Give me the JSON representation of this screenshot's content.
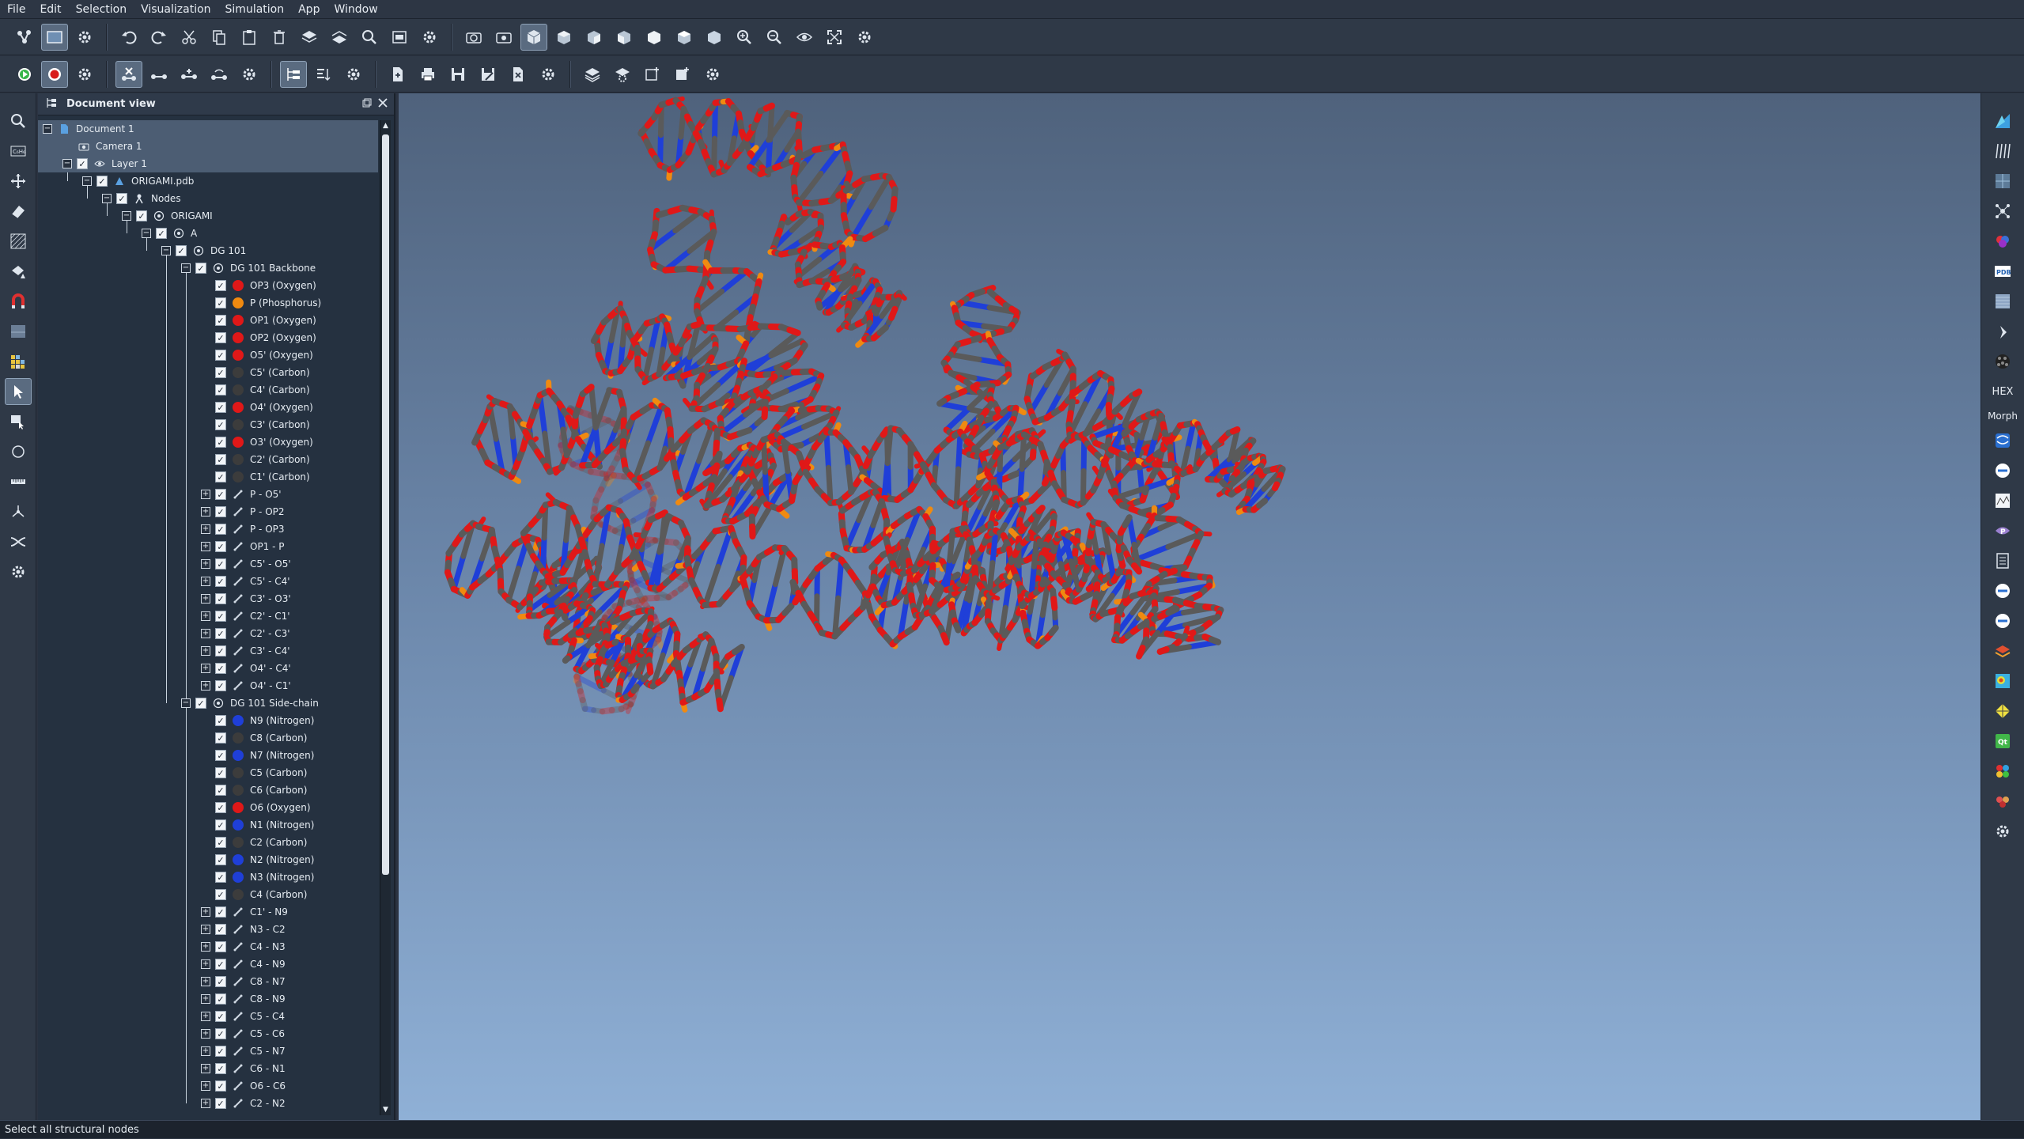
{
  "menu": [
    "File",
    "Edit",
    "Selection",
    "Visualization",
    "Simulation",
    "App",
    "Window"
  ],
  "document_view": {
    "title": "Document view"
  },
  "tree": [
    {
      "label": "Document 1",
      "level": 0,
      "type": "doc",
      "sel": "sel"
    },
    {
      "label": "Camera 1",
      "level": 1,
      "type": "camera",
      "sel": "sel"
    },
    {
      "label": "Layer 1",
      "level": 1,
      "type": "layer",
      "sel": "sel"
    },
    {
      "label": "ORIGAMI.pdb",
      "level": 2,
      "type": "file"
    },
    {
      "label": "Nodes",
      "level": 3,
      "type": "nodes"
    },
    {
      "label": "ORIGAMI",
      "level": 4,
      "type": "struct"
    },
    {
      "label": "A",
      "level": 5,
      "type": "struct"
    },
    {
      "label": "DG 101",
      "level": 6,
      "type": "struct"
    },
    {
      "label": "DG 101 Backbone",
      "level": 7,
      "type": "struct"
    },
    {
      "label": "OP3 (Oxygen)",
      "level": 8,
      "type": "atom",
      "color": "#e01818"
    },
    {
      "label": "P (Phosphorus)",
      "level": 8,
      "type": "atom",
      "color": "#f08a10"
    },
    {
      "label": "OP1 (Oxygen)",
      "level": 8,
      "type": "atom",
      "color": "#e01818"
    },
    {
      "label": "OP2 (Oxygen)",
      "level": 8,
      "type": "atom",
      "color": "#e01818"
    },
    {
      "label": "O5' (Oxygen)",
      "level": 8,
      "type": "atom",
      "color": "#e01818"
    },
    {
      "label": "C5' (Carbon)",
      "level": 8,
      "type": "atom",
      "color": "#3c3c3c"
    },
    {
      "label": "C4' (Carbon)",
      "level": 8,
      "type": "atom",
      "color": "#3c3c3c"
    },
    {
      "label": "O4' (Oxygen)",
      "level": 8,
      "type": "atom",
      "color": "#e01818"
    },
    {
      "label": "C3' (Carbon)",
      "level": 8,
      "type": "atom",
      "color": "#3c3c3c"
    },
    {
      "label": "O3' (Oxygen)",
      "level": 8,
      "type": "atom",
      "color": "#e01818"
    },
    {
      "label": "C2' (Carbon)",
      "level": 8,
      "type": "atom",
      "color": "#3c3c3c"
    },
    {
      "label": "C1' (Carbon)",
      "level": 8,
      "type": "atom",
      "color": "#3c3c3c"
    },
    {
      "label": "P - O5'",
      "level": 8,
      "type": "bond"
    },
    {
      "label": "P - OP2",
      "level": 8,
      "type": "bond"
    },
    {
      "label": "P - OP3",
      "level": 8,
      "type": "bond"
    },
    {
      "label": "OP1 - P",
      "level": 8,
      "type": "bond"
    },
    {
      "label": "C5' - O5'",
      "level": 8,
      "type": "bond"
    },
    {
      "label": "C5' - C4'",
      "level": 8,
      "type": "bond"
    },
    {
      "label": "C3' - O3'",
      "level": 8,
      "type": "bond"
    },
    {
      "label": "C2' - C1'",
      "level": 8,
      "type": "bond"
    },
    {
      "label": "C2' - C3'",
      "level": 8,
      "type": "bond"
    },
    {
      "label": "C3' - C4'",
      "level": 8,
      "type": "bond"
    },
    {
      "label": "O4' - C4'",
      "level": 8,
      "type": "bond"
    },
    {
      "label": "O4' - C1'",
      "level": 8,
      "type": "bond"
    },
    {
      "label": "DG 101 Side-chain",
      "level": 7,
      "type": "struct"
    },
    {
      "label": "N9 (Nitrogen)",
      "level": 8,
      "type": "atom",
      "color": "#1f3fd8"
    },
    {
      "label": "C8 (Carbon)",
      "level": 8,
      "type": "atom",
      "color": "#3c3c3c"
    },
    {
      "label": "N7 (Nitrogen)",
      "level": 8,
      "type": "atom",
      "color": "#1f3fd8"
    },
    {
      "label": "C5 (Carbon)",
      "level": 8,
      "type": "atom",
      "color": "#3c3c3c"
    },
    {
      "label": "C6 (Carbon)",
      "level": 8,
      "type": "atom",
      "color": "#3c3c3c"
    },
    {
      "label": "O6 (Oxygen)",
      "level": 8,
      "type": "atom",
      "color": "#e01818"
    },
    {
      "label": "N1 (Nitrogen)",
      "level": 8,
      "type": "atom",
      "color": "#1f3fd8"
    },
    {
      "label": "C2 (Carbon)",
      "level": 8,
      "type": "atom",
      "color": "#3c3c3c"
    },
    {
      "label": "N2 (Nitrogen)",
      "level": 8,
      "type": "atom",
      "color": "#1f3fd8"
    },
    {
      "label": "N3 (Nitrogen)",
      "level": 8,
      "type": "atom",
      "color": "#1f3fd8"
    },
    {
      "label": "C4 (Carbon)",
      "level": 8,
      "type": "atom",
      "color": "#3c3c3c"
    },
    {
      "label": "C1' - N9",
      "level": 8,
      "type": "bond"
    },
    {
      "label": "N3 - C2",
      "level": 8,
      "type": "bond"
    },
    {
      "label": "C4 - N3",
      "level": 8,
      "type": "bond"
    },
    {
      "label": "C4 - N9",
      "level": 8,
      "type": "bond"
    },
    {
      "label": "C8 - N7",
      "level": 8,
      "type": "bond"
    },
    {
      "label": "C8 - N9",
      "level": 8,
      "type": "bond"
    },
    {
      "label": "C5 - C4",
      "level": 8,
      "type": "bond"
    },
    {
      "label": "C5 - C6",
      "level": 8,
      "type": "bond"
    },
    {
      "label": "C5 - N7",
      "level": 8,
      "type": "bond"
    },
    {
      "label": "C6 - N1",
      "level": 8,
      "type": "bond"
    },
    {
      "label": "O6 - C6",
      "level": 8,
      "type": "bond"
    },
    {
      "label": "C2 - N2",
      "level": 8,
      "type": "bond"
    }
  ],
  "right_tools": {
    "hex_label": "HEX",
    "morph_label": "Morph",
    "pdb_label": "PDB"
  },
  "status": {
    "text": "Select all structural nodes"
  },
  "colors": {
    "oxygen": "#e01818",
    "phosphorus": "#f08a10",
    "carbon": "#5a5a5a",
    "nitrogen": "#1f3fd8"
  }
}
